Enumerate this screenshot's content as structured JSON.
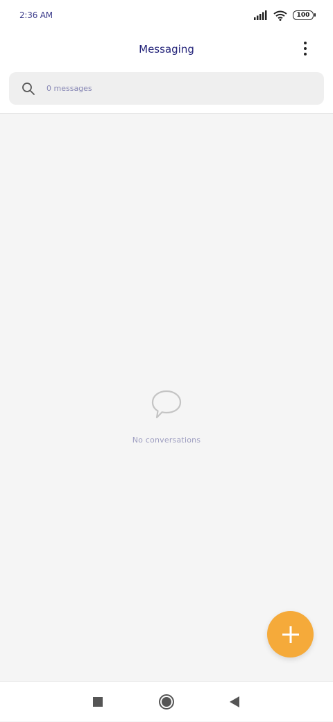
{
  "status_bar": {
    "time": "2:36 AM",
    "battery": "100",
    "icons": [
      "signal-icon",
      "wifi-icon",
      "battery-icon"
    ]
  },
  "header": {
    "title": "Messaging",
    "menu_icon": "more-vertical-icon"
  },
  "search": {
    "placeholder": "0 messages",
    "icon": "search-icon"
  },
  "empty_state": {
    "icon": "chat-bubble-icon",
    "text": "No conversations"
  },
  "fab": {
    "icon": "plus-icon",
    "color": "#f5aa3a"
  },
  "nav_bar": {
    "buttons": [
      "recents-square-icon",
      "home-circle-icon",
      "back-triangle-icon"
    ]
  },
  "colors": {
    "title": "#24247a",
    "background": "#f5f5f5",
    "accent": "#f5aa3a"
  }
}
